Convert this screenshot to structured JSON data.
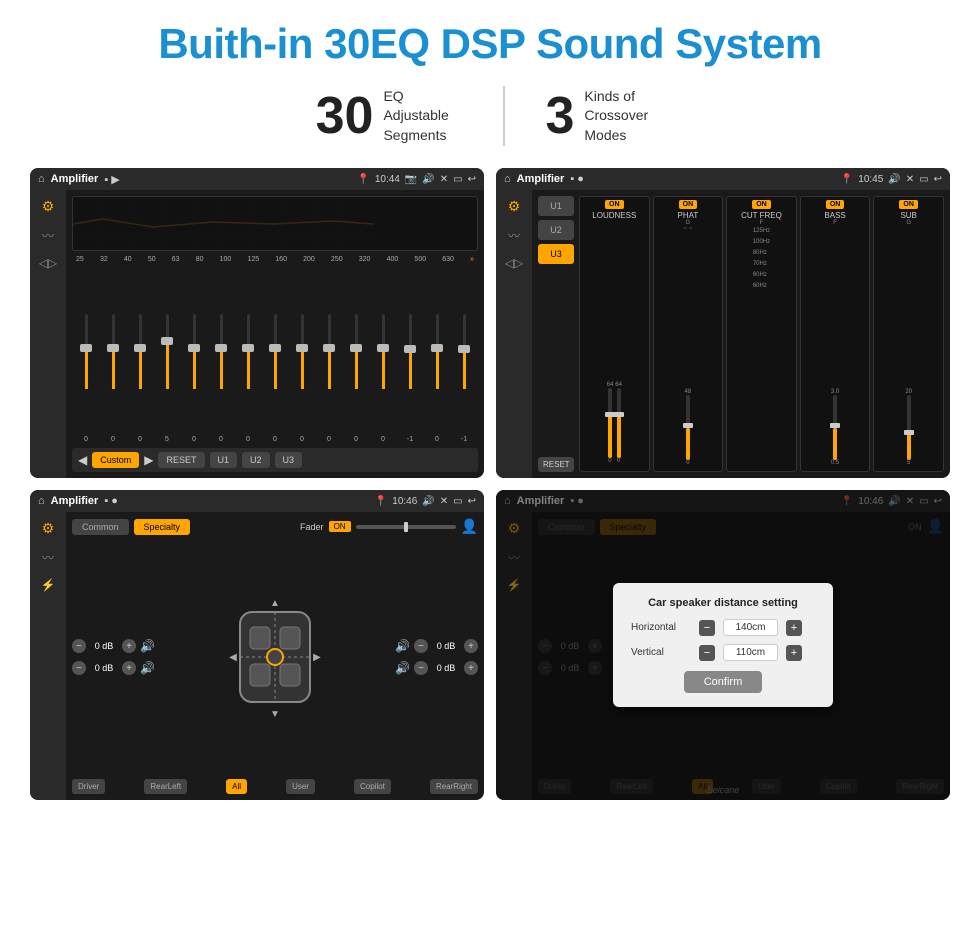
{
  "header": {
    "title": "Buith-in 30EQ DSP Sound System",
    "stat1_number": "30",
    "stat1_desc": "EQ Adjustable\nSegments",
    "stat2_number": "3",
    "stat2_desc": "Kinds of\nCrossover Modes"
  },
  "screen1": {
    "title": "Amplifier",
    "time": "10:44",
    "app": "Custom",
    "freqs": [
      "25",
      "32",
      "40",
      "50",
      "63",
      "80",
      "100",
      "125",
      "160",
      "200",
      "250",
      "320",
      "400",
      "500",
      "630"
    ],
    "values": [
      "0",
      "0",
      "0",
      "5",
      "0",
      "0",
      "0",
      "0",
      "0",
      "0",
      "0",
      "0",
      "-1",
      "0",
      "-1"
    ],
    "presets": [
      "RESET",
      "U1",
      "U2",
      "U3"
    ]
  },
  "screen2": {
    "title": "Amplifier",
    "time": "10:45",
    "presets": [
      "U1",
      "U2",
      "U3"
    ],
    "channels": [
      "LOUDNESS",
      "PHAT",
      "CUT FREQ",
      "BASS",
      "SUB"
    ],
    "on_states": [
      true,
      true,
      true,
      true,
      true
    ],
    "reset_label": "RESET"
  },
  "screen3": {
    "title": "Amplifier",
    "time": "10:46",
    "tabs": [
      "Common",
      "Specialty"
    ],
    "active_tab": "Specialty",
    "fader_label": "Fader",
    "fader_on": "ON",
    "vol_labels": [
      "0 dB",
      "0 dB",
      "0 dB",
      "0 dB"
    ],
    "speaker_btns": [
      "Driver",
      "RearLeft",
      "All",
      "User",
      "Copilot",
      "RearRight"
    ]
  },
  "screen4": {
    "title": "Amplifier",
    "time": "10:46",
    "tabs": [
      "Common",
      "Specialty"
    ],
    "dialog": {
      "title": "Car speaker distance setting",
      "horizontal_label": "Horizontal",
      "horizontal_value": "140cm",
      "vertical_label": "Vertical",
      "vertical_value": "110cm",
      "confirm_label": "Confirm"
    },
    "speaker_btns": [
      "Driver",
      "RearLeft",
      "All",
      "User",
      "Copilot",
      "RearRight"
    ],
    "vol_labels": [
      "0 dB",
      "0 dB"
    ]
  },
  "watermark": "Seicane"
}
